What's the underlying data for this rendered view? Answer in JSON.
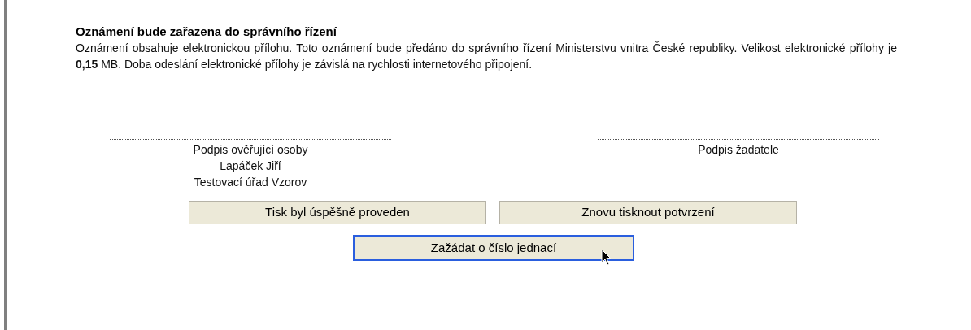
{
  "notice": {
    "title": "Oznámení bude zařazena do správního řízení",
    "text": "Oznámení obsahuje elektronickou přílohu. Toto oznámení bude předáno do správního řízení Ministerstvu vnitra České republiky. Velikost elektronické přílohy je **0,15** MB. Doba odeslání elektronické přílohy je závislá na rychlosti internetového připojení."
  },
  "signatures": [
    {
      "lines": [
        "Podpis ověřující osoby",
        "Lapáček Jiří",
        "Testovací úřad Vzorov"
      ]
    },
    {
      "lines": [
        "Podpis žadatele"
      ]
    }
  ],
  "buttons": [
    {
      "label": "Tisk byl úspěšně proveden",
      "focused": false
    },
    {
      "label": "Znovu tisknout potvrzení",
      "focused": false
    }
  ],
  "primary_button": {
    "label": "Zažádat o číslo jednací",
    "focused": true
  }
}
